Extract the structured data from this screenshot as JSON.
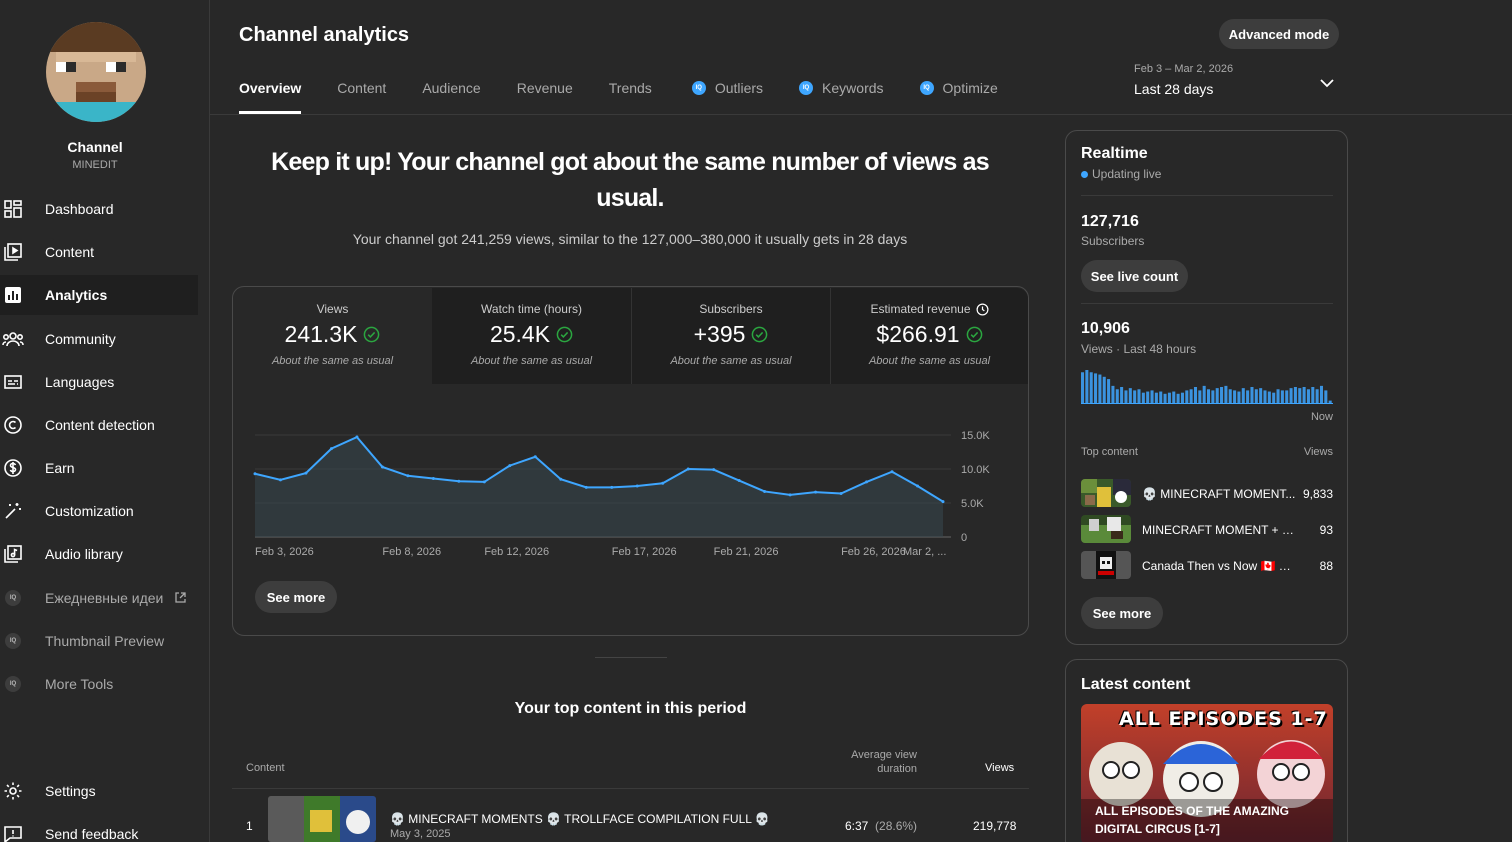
{
  "channel": {
    "name": "Channel",
    "handle": "MINEDIT"
  },
  "sidebar": {
    "items": [
      {
        "label": "Dashboard",
        "icon": "dashboard-icon"
      },
      {
        "label": "Content",
        "icon": "content-icon"
      },
      {
        "label": "Analytics",
        "icon": "analytics-icon",
        "active": true
      },
      {
        "label": "Community",
        "icon": "community-icon"
      },
      {
        "label": "Languages",
        "icon": "languages-icon"
      },
      {
        "label": "Content detection",
        "icon": "copyright-icon"
      },
      {
        "label": "Earn",
        "icon": "dollar-icon"
      },
      {
        "label": "Customization",
        "icon": "magic-wand-icon"
      },
      {
        "label": "Audio library",
        "icon": "audio-library-icon"
      },
      {
        "label": "Ежедневные идеи",
        "icon": "iq-icon"
      },
      {
        "label": "Thumbnail Preview",
        "icon": "iq-icon"
      },
      {
        "label": "More Tools",
        "icon": "iq-icon"
      },
      {
        "label": "Settings",
        "icon": "gear-icon"
      },
      {
        "label": "Send feedback",
        "icon": "feedback-icon"
      }
    ],
    "iq_badge": "IQ"
  },
  "header": {
    "title": "Channel analytics",
    "advanced_mode": "Advanced mode",
    "date_range": "Feb 3 – Mar 2, 2026",
    "date_label": "Last 28 days",
    "tabs": [
      "Overview",
      "Content",
      "Audience",
      "Revenue",
      "Trends",
      "Outliers",
      "Keywords",
      "Optimize"
    ]
  },
  "summary": {
    "headline": "Keep it up! Your channel got about the same number of views as usual.",
    "subline": "Your channel got 241,259 views, similar to the 127,000–380,000 it usually gets in 28 days"
  },
  "metrics": [
    {
      "label": "Views",
      "value": "241.3K",
      "note": "About the same as usual"
    },
    {
      "label": "Watch time (hours)",
      "value": "25.4K",
      "note": "About the same as usual"
    },
    {
      "label": "Subscribers",
      "value": "+395",
      "note": "About the same as usual"
    },
    {
      "label": "Estimated revenue",
      "value": "$266.91",
      "note": "About the same as usual"
    }
  ],
  "chart_data": {
    "type": "area",
    "title": "",
    "xlabel": "",
    "ylabel": "",
    "ylim": [
      0,
      15000
    ],
    "yticks": [
      "15.0K",
      "10.0K",
      "5.0K",
      "0"
    ],
    "x_tick_labels": [
      "Feb 3, 2026",
      "Feb 8, 2026",
      "Feb 12, 2026",
      "Feb 17, 2026",
      "Feb 21, 2026",
      "Feb 26, 2026",
      "Mar 2, ..."
    ],
    "x": [
      "Feb 3",
      "Feb 4",
      "Feb 5",
      "Feb 6",
      "Feb 7",
      "Feb 8",
      "Feb 9",
      "Feb 10",
      "Feb 11",
      "Feb 12",
      "Feb 13",
      "Feb 14",
      "Feb 15",
      "Feb 16",
      "Feb 17",
      "Feb 18",
      "Feb 19",
      "Feb 20",
      "Feb 21",
      "Feb 22",
      "Feb 23",
      "Feb 24",
      "Feb 25",
      "Feb 26",
      "Feb 27",
      "Feb 28",
      "Mar 1",
      "Mar 2"
    ],
    "series": [
      {
        "values": [
          9300,
          8400,
          9400,
          13000,
          14700,
          10300,
          9000,
          8600,
          8200,
          8100,
          10500,
          11800,
          8500,
          7300,
          7300,
          7500,
          7900,
          10000,
          9900,
          8300,
          6700,
          6200,
          6600,
          6400,
          8100,
          9600,
          7500,
          5200
        ],
        "color": "#3ea6ff"
      }
    ],
    "grid": true,
    "grid_lines": 4
  },
  "stats_see_more": "See more",
  "realtime": {
    "title": "Realtime",
    "status": "Updating live",
    "subscribers_value": "127,716",
    "subscribers_label": "Subscribers",
    "live_count_btn": "See live count",
    "views_value": "10,906",
    "views_label": "Views · Last 48 hours",
    "now_label": "Now",
    "bar_values": [
      28,
      30,
      28,
      27,
      26,
      24,
      22,
      16,
      13,
      15,
      12,
      14,
      12,
      13,
      10,
      11,
      12,
      10,
      11,
      9,
      10,
      11,
      9,
      10,
      12,
      13,
      15,
      12,
      16,
      13,
      12,
      14,
      15,
      16,
      13,
      12,
      11,
      14,
      12,
      15,
      13,
      14,
      12,
      11,
      10,
      13,
      12,
      12,
      14,
      15,
      14,
      15,
      13,
      15,
      13,
      16,
      12,
      3
    ],
    "top_content_label": "Top content",
    "views_col_label": "Views",
    "top_items": [
      {
        "title": "💀 MINECRAFT MOMENT...",
        "views": "9,833"
      },
      {
        "title": "MINECRAFT MOMENT + CO...",
        "views": "93"
      },
      {
        "title": "Canada Then vs Now 🇨🇦 #co...",
        "views": "88"
      }
    ],
    "see_more": "See more"
  },
  "latest": {
    "title": "Latest content",
    "thumb_banner": "ALL EPISODES 1-7",
    "video_title": "ALL EPISODES OF THE AMAZING DIGITAL CIRCUS [1-7]"
  },
  "top_content": {
    "title": "Your top content in this period",
    "col_content": "Content",
    "col_avd": "Average view duration",
    "col_views": "Views",
    "rows": [
      {
        "rank": "1",
        "title": "💀 MINECRAFT MOMENTS 💀 TROLLFACE COMPILATION FULL 💀",
        "date": "May 3, 2025",
        "avd": "6:37",
        "avd_pct": "(28.6%)",
        "views": "219,778"
      }
    ]
  }
}
